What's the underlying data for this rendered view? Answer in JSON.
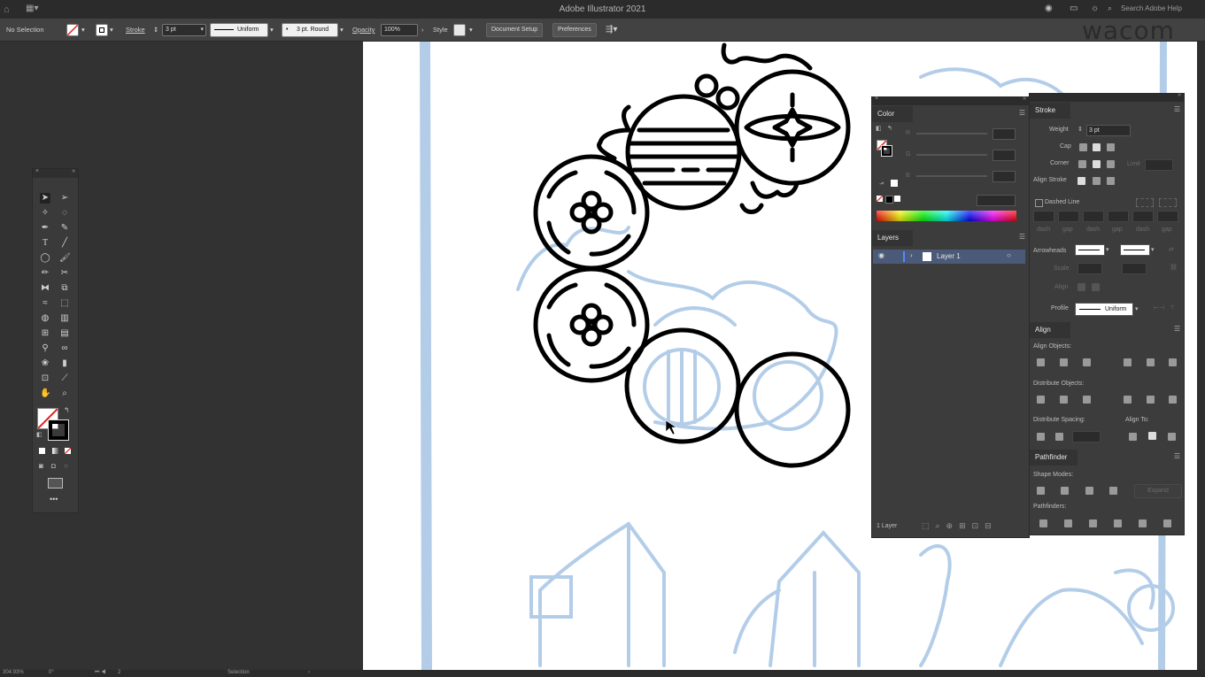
{
  "app": {
    "title": "Adobe Illustrator 2021",
    "watermark": "wacom"
  },
  "titlebar": {
    "search_placeholder": "Search Adobe Help"
  },
  "controlbar": {
    "selection": "No Selection",
    "stroke_label": "Stroke",
    "stroke_weight": "3 pt",
    "profile": "Uniform",
    "brush": "3 pt. Round",
    "opacity_label": "Opacity",
    "opacity": "100%",
    "style_label": "Style",
    "document_setup": "Document Setup",
    "preferences": "Preferences"
  },
  "color_panel": {
    "title": "Color",
    "channels": [
      "R",
      "G",
      "B"
    ]
  },
  "layers_panel": {
    "title": "Layers",
    "layer_name": "Layer 1",
    "footer": "1 Layer"
  },
  "stroke_panel": {
    "title": "Stroke",
    "weight_label": "Weight",
    "weight": "3 pt",
    "cap_label": "Cap",
    "corner_label": "Corner",
    "limit_label": "Limit",
    "align_stroke_label": "Align Stroke",
    "dashed_line": "Dashed Line",
    "dash_labels": [
      "dash",
      "gap",
      "dash",
      "gap",
      "dash",
      "gap"
    ],
    "arrowheads_label": "Arrowheads",
    "scale_label": "Scale",
    "align_label": "Align",
    "profile_label": "Profile",
    "profile": "Uniform"
  },
  "align_panel": {
    "title": "Align",
    "align_objects": "Align Objects:",
    "distribute_objects": "Distribute Objects:",
    "distribute_spacing": "Distribute Spacing:",
    "align_to": "Align To:"
  },
  "pathfinder_panel": {
    "title": "Pathfinder",
    "shape_modes": "Shape Modes:",
    "pathfinders": "Pathfinders:",
    "expand": "Expand"
  },
  "statusbar": {
    "zoom": "304.93%",
    "rotation": "0°",
    "artboard": "2",
    "tool": "Selection"
  },
  "colors": {
    "canvas": "#ffffff",
    "sketch": "#b3cde9",
    "ink": "#000000",
    "ui_bg": "#323232",
    "panel": "#3c3c3c"
  }
}
